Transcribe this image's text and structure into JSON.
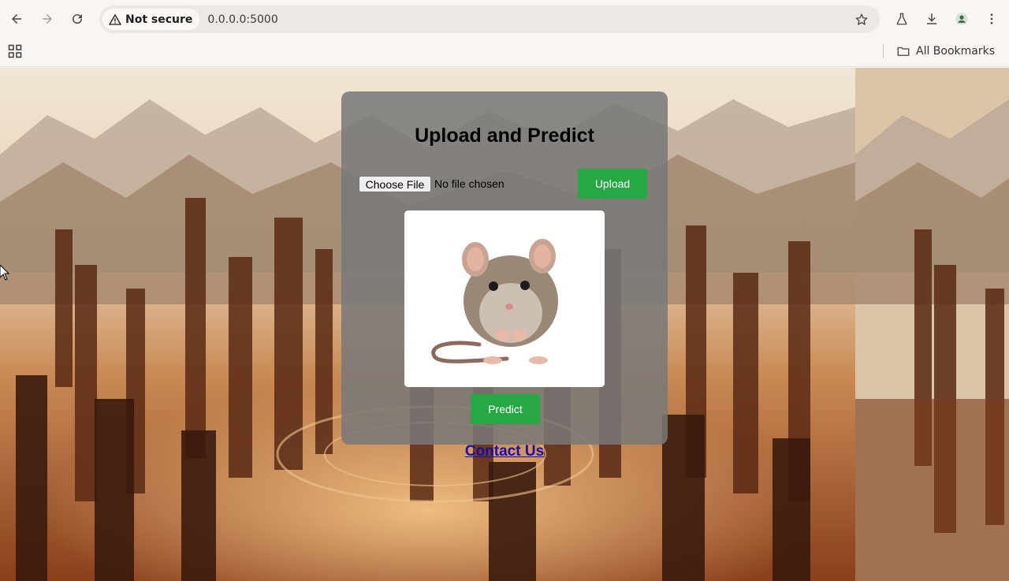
{
  "browser": {
    "security_label": "Not secure",
    "url": "0.0.0.0:5000",
    "bookmarks_label": "All Bookmarks",
    "icons": {
      "back": "arrow-left-icon",
      "forward": "arrow-right-icon",
      "reload": "reload-icon",
      "security": "warning-triangle-icon",
      "star": "star-icon",
      "labs": "flask-icon",
      "download": "download-icon",
      "profile": "profile-icon",
      "menu": "kebab-menu-icon",
      "apps": "apps-grid-icon",
      "folder": "folder-icon"
    }
  },
  "page": {
    "title": "Upload and Predict",
    "file_input": {
      "button_label": "Choose File",
      "status": "No file chosen"
    },
    "upload_label": "Upload",
    "predict_label": "Predict",
    "contact_label": "Contact Us",
    "accent_color": "#28a745",
    "link_color": "#1a0dab"
  }
}
